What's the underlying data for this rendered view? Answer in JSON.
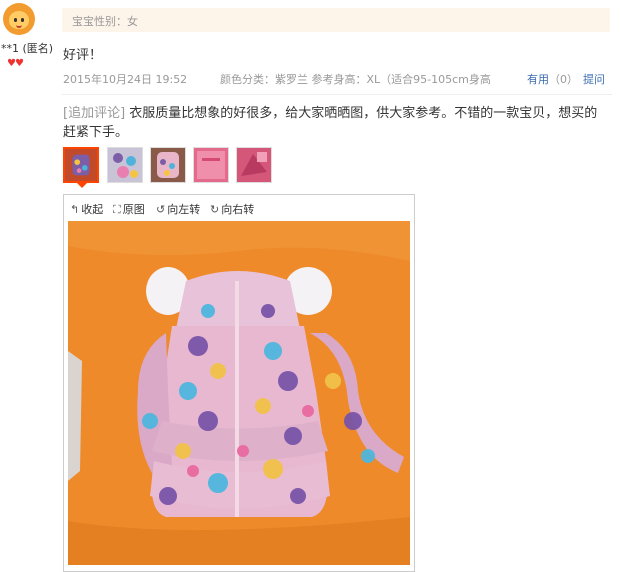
{
  "user": {
    "name": "**1 (匿名)",
    "rank_icon": "♥♥"
  },
  "review": {
    "gender_label": "宝宝性别：女",
    "text": "好评！",
    "date": "2015年10月24日 19:52",
    "sku": "颜色分类：紫罗兰   参考身高：XL（适合95-105cm身高",
    "useful_label": "有用",
    "useful_count": "（0）",
    "ask_label": "提问"
  },
  "append": {
    "tag": "[追加评论]",
    "text": " 衣服质量比想象的好很多，给大家晒晒图，供大家参考。不错的一款宝贝，想买的赶紧下手。"
  },
  "thumbnails": [
    {
      "color": "#c04a2a",
      "active": true
    },
    {
      "color": "#9a8bb5",
      "active": false
    },
    {
      "color": "#b07a78",
      "active": false
    },
    {
      "color": "#e46a8c",
      "active": false
    },
    {
      "color": "#d4577a",
      "active": false
    }
  ],
  "viewer": {
    "collapse_label": "收起",
    "original_label": "原图",
    "rotate_left_label": "向左转",
    "rotate_right_label": "向右转"
  },
  "colors": {
    "accent_blue": "#3c6db0",
    "accent_orange": "#f40",
    "photo_bg": "#ee8a2a"
  }
}
